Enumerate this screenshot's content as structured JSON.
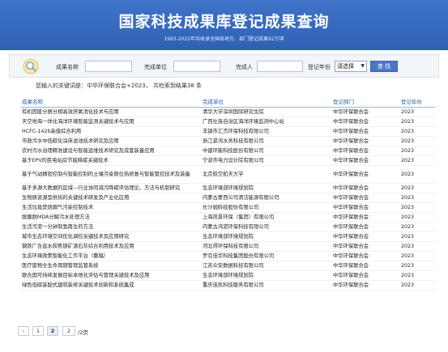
{
  "header": {
    "title": "国家科技成果库登记成果查询",
    "subtitle": "1993-2022年共收录全国各地方、部门登记成果92万项"
  },
  "search": {
    "name_label": "成果名称",
    "unit_label": "完成单位",
    "person_label": "完成人",
    "year_label": "登记年份",
    "year_value": "请选择",
    "button_label": "查 找"
  },
  "summary": "您输入的关键词是：中华环保联合会+2023， 共检索到结果38 条",
  "table": {
    "headers": [
      "成果名称",
      "完成单位",
      "登记部门",
      "登记年份"
    ],
    "rows": [
      [
        "有机固废分质分相高效厌氧消化技术与应用",
        "清华大学深圳国际研究生院",
        "中华环保联合会",
        "2023"
      ],
      [
        "天空地海一体化海洋环境智能监测关键技术与应用",
        "广西壮族自治区海洋环境监测中心站",
        "中华环保联合会",
        "2023"
      ],
      [
        "HCFC-142b高值综合利用",
        "丰镇市汇杰环保科技有限公司",
        "中华环保联合会",
        "2023"
      ],
      [
        "市政污水中低碳化深床滤池技术研究及应用",
        "浙江景鸿水务科技有限公司",
        "中华环保联合会",
        "2023"
      ],
      [
        "农村污水治理精准建设与智能运维技术研究及成套装备应用",
        "中建环能科技股份有限公司",
        "中华环保联合会",
        "2023"
      ],
      [
        "基于EPV的民电站房节能降碳关键技术",
        "宁波市电力设计院有限公司",
        "中华环保联合会",
        "2023"
      ],
      [
        "基于气动精密控制与智能控制的土壤污染原位热修复与智能管控技术及装备",
        "北京航空航天大学",
        "中华环保联合会",
        "2023"
      ],
      [
        "基于多源大数据的区域—行业协同减污降碳评估理论、方法与机制研究",
        "生态环境部环境规划院",
        "中华环保联合会",
        "2023"
      ],
      [
        "生物质资源型供热的关键技术研发及产业化应用",
        "内蒙古蒙西公司清洁能源有限公司",
        "中华环保联合会",
        "2023"
      ],
      [
        "生活垃圾焚烧烟气污染控制技术",
        "长沙驰科技股份有限公司",
        "中华环保联合会",
        "2023"
      ],
      [
        "脱脲脱MDA分解污水处理方法",
        "上海凯景环保（集团）有限公司",
        "中华环保联合会",
        "2023"
      ],
      [
        "生活污泥一分钟制氢再生的方法",
        "内蒙古鸿泥环保科技有限公司",
        "中华环保联合会",
        "2023"
      ],
      [
        "城市生态环境空间优化调控关键技术及应用研究",
        "生态环境部环境规划院",
        "中华环保联合会",
        "2023"
      ],
      [
        "钢铁厂含盐水和焦镁矿渣石灰综合利用技术及应用",
        "河北得环保科技有限公司",
        "中华环保联合会",
        "2023"
      ],
      [
        "生态环境政策智能化工作平台（撒稿）",
        "罗克佳华科技集团股份有限公司",
        "中华环保联合会",
        "2023"
      ],
      [
        "医疗废物全生命周期管理监管系统",
        "江苏众安数据科技有限公司",
        "中华环保联合会",
        "2023"
      ],
      [
        "联合国可持续发展目标本地化评估与管理关键技术及应用",
        "生态环境部环境规划院",
        "中华环保联合会",
        "2023"
      ],
      [
        "绿色低碳装配式建筑装修关键技术创新和系统集成",
        "重庆佳凯科技服务有限公司",
        "中华环保联合会",
        "2023"
      ]
    ]
  },
  "pager": {
    "first": "‹",
    "page1": "1",
    "page2": "2",
    "input_value": "2",
    "total_text": "/2页"
  },
  "colors": {
    "banner": "#3569bd",
    "header_text": "#1e5fb3",
    "button": "#4a78c6"
  }
}
